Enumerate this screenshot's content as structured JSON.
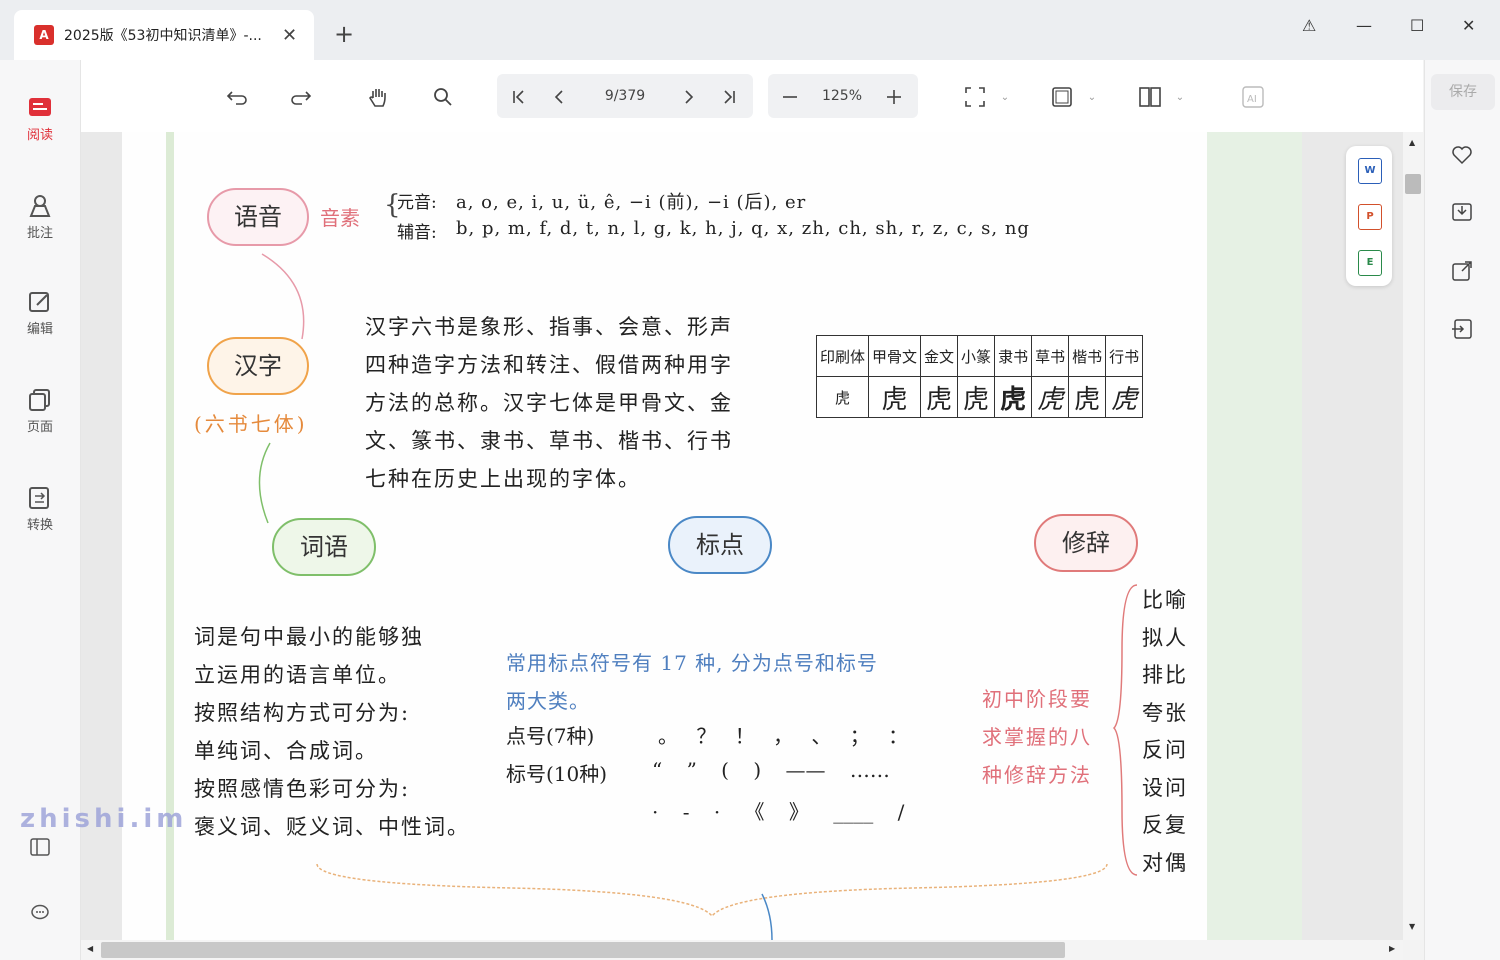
{
  "window": {
    "tab_title": "2025版《53初中知识清单》-...",
    "new_tab": "+",
    "pdf_badge": "A",
    "controls": [
      "⚠",
      "—",
      "☐",
      "✕"
    ]
  },
  "sidebar": {
    "items": [
      {
        "label": "阅读",
        "icon": "read-icon"
      },
      {
        "label": "批注",
        "icon": "annotate-icon"
      },
      {
        "label": "编辑",
        "icon": "edit-icon"
      },
      {
        "label": "页面",
        "icon": "pages-icon"
      },
      {
        "label": "转换",
        "icon": "convert-icon"
      }
    ]
  },
  "toolbar": {
    "page_indicator": "9/379",
    "zoom": "125%"
  },
  "right_panel": {
    "save_label": "保存"
  },
  "float_tools": [
    "W",
    "P",
    "E"
  ],
  "document": {
    "bubbles": {
      "yuyin": "语音",
      "hanzi": "汉字",
      "ciyu": "词语",
      "biaodian": "标点",
      "xiuci": "修辞"
    },
    "yinsu": "音素",
    "vowels_label": "元音:",
    "vowels": "a, o, e, i, u, ü, ê, −i (前), −i (后), er",
    "consonants_label": "辅音:",
    "consonants": "b, p, m, f, d, t, n, l, g, k, h, j, q, x, zh, ch, sh, r, z, c, s, ng",
    "liushu": "(六书七体)",
    "hanzi_text": [
      "汉字六书是象形、指事、会意、形声",
      "四种造字方法和转注、假借两种用字",
      "方法的总称。汉字七体是甲骨文、金",
      "文、篆书、隶书、草书、楷书、行书",
      "七种在历史上出现的字体。"
    ],
    "script_table": {
      "headers": [
        "印刷体",
        "甲骨文",
        "金文",
        "小篆",
        "隶书",
        "草书",
        "楷书",
        "行书"
      ],
      "row": [
        "虎",
        "虎",
        "虎",
        "虎",
        "虎",
        "虎",
        "虎",
        "虎"
      ]
    },
    "ciyu_text": [
      "词是句中最小的能够独",
      "立运用的语言单位。",
      "按照结构方式可分为:",
      "单纯词、合成词。",
      "按照感情色彩可分为:",
      "褒义词、贬义词、中性词。"
    ],
    "biaodian_intro": [
      "常用标点符号有 17 种, 分为点号和标号",
      "两大类。"
    ],
    "dianhao_label": "点号(7种)",
    "dianhao_marks": "。 ？ ！ ， 、 ； ：",
    "biaohao_label": "标号(10种)",
    "biaohao_marks_1": "“ ” ( ) —— ……",
    "biaohao_marks_2": "· - · 《 》 ____ /",
    "xiuci_note": [
      "初中阶段要",
      "求掌握的八",
      "种修辞方法"
    ],
    "xiuci_list": [
      "比喻",
      "拟人",
      "排比",
      "夸张",
      "反问",
      "设问",
      "反复",
      "对偶"
    ]
  },
  "watermark": "zhishi.im",
  "colors": {
    "accent": "#e0303a",
    "yuyin_border": "#e79aa9",
    "hanzi_border": "#f0a34a",
    "ciyu_border": "#7fbf6a",
    "biaodian_border": "#4a88c6",
    "xiuci_border": "#e07a7a",
    "blue_text": "#4f7fbf",
    "pink_text": "#e0707a",
    "orange_text": "#e58a3c"
  }
}
